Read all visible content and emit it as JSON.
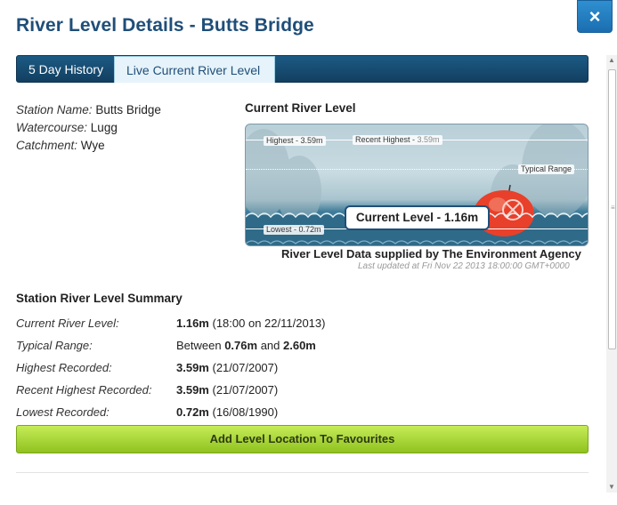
{
  "window": {
    "title": "River Level Details - Butts Bridge",
    "close_label": "×"
  },
  "tabs": [
    {
      "label": "5 Day History",
      "active": false
    },
    {
      "label": "Live Current River Level",
      "active": true
    }
  ],
  "station": {
    "name_label": "Station Name:",
    "name": "Butts Bridge",
    "watercourse_label": "Watercourse:",
    "watercourse": "Lugg",
    "catchment_label": "Catchment:",
    "catchment": "Wye"
  },
  "gauge": {
    "heading": "Current River Level",
    "highest_label": "Highest - 3.59m",
    "recent_highest_prefix": "Recent Highest - ",
    "recent_highest_value": "3.59m",
    "typical_range_label": "Typical Range",
    "lowest_label": "Lowest - 0.72m",
    "current_label": "Current Level - 1.16m",
    "supplied_by": "River Level Data supplied by The Environment Agency",
    "last_updated": "Last updated at Fri Nov 22 2013 18:00:00 GMT+0000",
    "colors": {
      "water": "#2f6a89",
      "buoy": "#e8402a",
      "frame": "#1f4e79"
    }
  },
  "summary": {
    "title": "Station River Level Summary",
    "rows": [
      {
        "label": "Current River Level:",
        "value_bold": "1.16m",
        "value_rest": " (18:00 on 22/11/2013)"
      },
      {
        "label": "Typical Range:",
        "value_pre": "Between ",
        "value_bold": "0.76m",
        "value_mid": " and ",
        "value_bold2": "2.60m"
      },
      {
        "label": "Highest Recorded:",
        "value_bold": "3.59m",
        "value_rest": " (21/07/2007)"
      },
      {
        "label": "Recent Highest Recorded:",
        "value_bold": "3.59m",
        "value_rest": " (21/07/2007)"
      },
      {
        "label": "Lowest Recorded:",
        "value_bold": "0.72m",
        "value_rest": " (16/08/1990)"
      }
    ]
  },
  "actions": {
    "favourite_label": "Add Level Location To Favourites",
    "button_color": "#9ccc26"
  },
  "icons": {
    "close": "close-icon",
    "scroll_up": "scroll-up-arrow-icon",
    "scroll_down": "scroll-down-arrow-icon",
    "buoy": "buoy-icon"
  }
}
